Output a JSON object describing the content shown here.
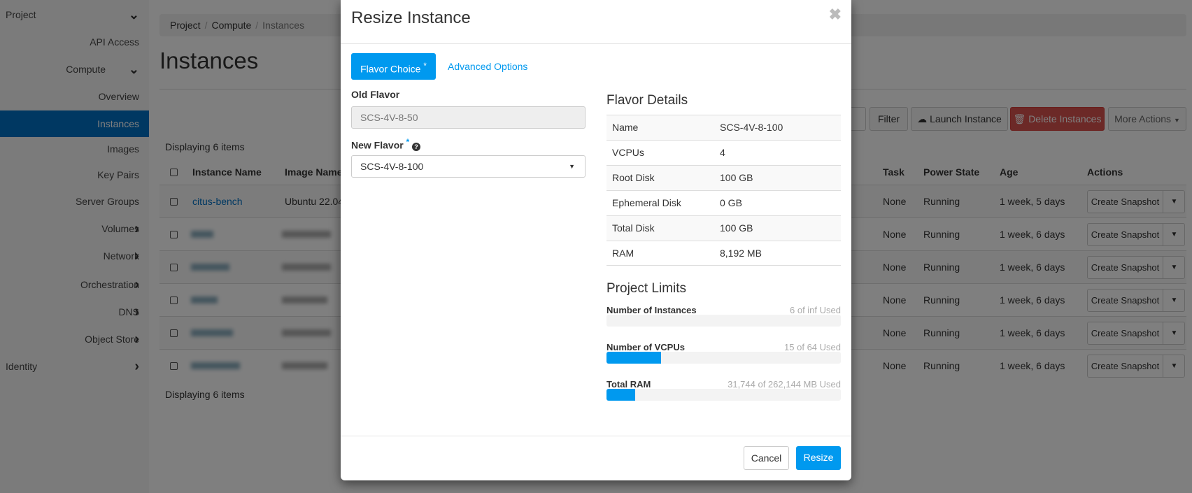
{
  "sidebar": {
    "items": [
      {
        "label": "Project",
        "chevron": "down"
      },
      {
        "label": "API Access"
      },
      {
        "label": "Compute",
        "chevron": "down"
      },
      {
        "label": "Overview"
      },
      {
        "label": "Instances",
        "active": true
      },
      {
        "label": "Images"
      },
      {
        "label": "Key Pairs"
      },
      {
        "label": "Server Groups"
      },
      {
        "label": "Volumes",
        "chevron": "right"
      },
      {
        "label": "Network",
        "chevron": "right"
      },
      {
        "label": "Orchestration",
        "chevron": "right"
      },
      {
        "label": "DNS",
        "chevron": "right"
      },
      {
        "label": "Object Store",
        "chevron": "right"
      },
      {
        "label": "Identity",
        "chevron": "right"
      }
    ]
  },
  "breadcrumb": [
    "Project",
    "Compute",
    "Instances"
  ],
  "page_title": "Instances",
  "toolbar": {
    "filter": "Filter",
    "launch": "Launch Instance",
    "delete": "Delete Instances",
    "more": "More Actions"
  },
  "displaying": "Displaying 6 items",
  "table": {
    "headers": {
      "name": "Instance Name",
      "image": "Image Name",
      "task": "Task",
      "power": "Power State",
      "age": "Age",
      "actions": "Actions"
    },
    "rows": [
      {
        "name": "citus-bench",
        "image": "Ubuntu 22.04",
        "task": "None",
        "power": "Running",
        "age": "1 week, 5 days",
        "action": "Create Snapshot"
      },
      {
        "name": "",
        "image": "",
        "task": "None",
        "power": "Running",
        "age": "1 week, 6 days",
        "action": "Create Snapshot"
      },
      {
        "name": "",
        "image": "",
        "task": "None",
        "power": "Running",
        "age": "1 week, 6 days",
        "action": "Create Snapshot"
      },
      {
        "name": "",
        "image": "",
        "task": "None",
        "power": "Running",
        "age": "1 week, 6 days",
        "action": "Create Snapshot"
      },
      {
        "name": "",
        "image": "",
        "task": "None",
        "power": "Running",
        "age": "1 week, 6 days",
        "action": "Create Snapshot"
      },
      {
        "name": "",
        "image": "",
        "task": "None",
        "power": "Running",
        "age": "1 week, 6 days",
        "action": "Create Snapshot"
      }
    ]
  },
  "modal": {
    "title": "Resize Instance",
    "tabs": [
      "Flavor Choice",
      "Advanced Options"
    ],
    "required_mark": "*",
    "old_flavor_label": "Old Flavor",
    "old_flavor": "SCS-4V-8-50",
    "new_flavor_label": "New Flavor",
    "new_flavor": "SCS-4V-8-100",
    "flavor_details_title": "Flavor Details",
    "flavor_details": [
      {
        "k": "Name",
        "v": "SCS-4V-8-100"
      },
      {
        "k": "VCPUs",
        "v": "4"
      },
      {
        "k": "Root Disk",
        "v": "100 GB"
      },
      {
        "k": "Ephemeral Disk",
        "v": "0 GB"
      },
      {
        "k": "Total Disk",
        "v": "100 GB"
      },
      {
        "k": "RAM",
        "v": "8,192 MB"
      }
    ],
    "limits_title": "Project Limits",
    "limits": [
      {
        "label": "Number of Instances",
        "usage": "6 of inf Used",
        "fraction": 0
      },
      {
        "label": "Number of VCPUs",
        "usage": "15 of 64 Used",
        "fraction": 0.234
      },
      {
        "label": "Total RAM",
        "usage": "31,744 of 262,144 MB Used",
        "fraction": 0.121
      }
    ],
    "cancel": "Cancel",
    "submit": "Resize"
  },
  "colors": {
    "accent": "#0099ef",
    "sidebar_active": "#0071c5",
    "danger": "#d9534f"
  }
}
